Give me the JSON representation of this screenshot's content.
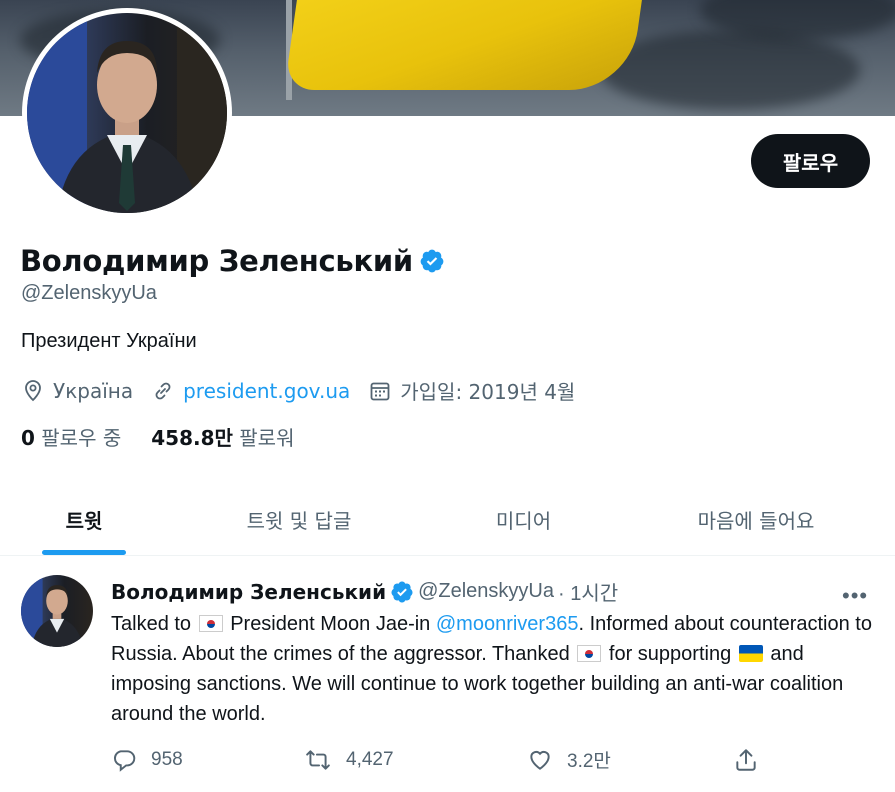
{
  "profile": {
    "name": "Володимир Зеленський",
    "handle": "@ZelenskyyUa",
    "bio": "Президент України",
    "location": "Україна",
    "website": "president.gov.ua",
    "joined": "가입일: 2019년 4월",
    "following_count": "0",
    "following_label": "팔로우 중",
    "followers_count": "458.8만",
    "followers_label": "팔로워",
    "follow_button": "팔로우"
  },
  "tabs": [
    {
      "label": "트윗",
      "active": true
    },
    {
      "label": "트윗 및 답글",
      "active": false
    },
    {
      "label": "미디어",
      "active": false
    },
    {
      "label": "마음에 들어요",
      "active": false
    }
  ],
  "tweet": {
    "author": "Володимир Зеленський",
    "handle": "@ZelenskyyUa",
    "time": "· 1시간",
    "text_1": "Talked to",
    "text_2": "President Moon Jae-in",
    "mention": "@moonriver365",
    "text_3": ". Informed about counteraction to Russia. About the crimes of the aggressor. Thanked",
    "text_4": "for supporting",
    "text_5": "and imposing sanctions. We will continue to work together building an anti-war coalition around the world.",
    "reply_count": "958",
    "retweet_count": "4,427",
    "like_count": "3.2만",
    "more": "•••"
  },
  "colors": {
    "accent": "#1d9bf0",
    "text_primary": "#0f1419",
    "text_secondary": "#536471",
    "button_bg": "#0f1419"
  }
}
